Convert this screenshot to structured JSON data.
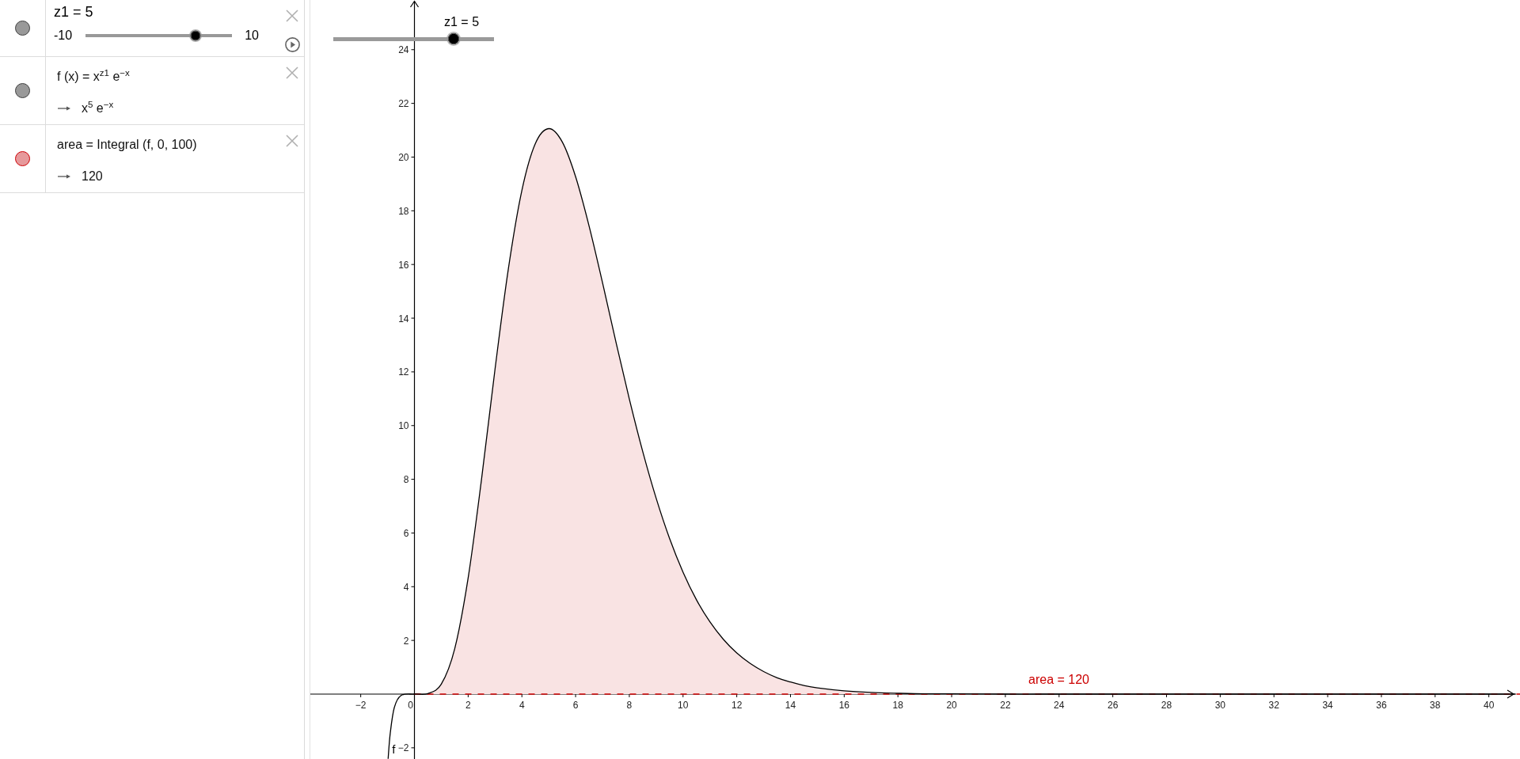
{
  "algebra_view": {
    "items": [
      {
        "kind": "slider",
        "visible": true,
        "color": "#999999",
        "definition": "z1 = 5",
        "min": "-10",
        "max": "10",
        "level": 0.75
      },
      {
        "kind": "formula",
        "visible": true,
        "color": "#999999",
        "definition": "f (x) = x$^{z1}$ e$^{−x}$",
        "output": "x$^{5}$ e$^{−x}$"
      },
      {
        "kind": "formula",
        "visible": true,
        "color": "#e6999b",
        "definition": "area = Integral (f, 0, 100)",
        "output": "120"
      }
    ]
  },
  "graphics_view": {
    "slider": {
      "caption": "z1 = 5",
      "level": 0.75
    },
    "chart_data": {
      "type": "line",
      "x": [
        -0.98,
        -0.9,
        -0.75,
        -0.5,
        0,
        0.5,
        1,
        1.5,
        2,
        2.5,
        3,
        3.5,
        4,
        4.5,
        5,
        5.5,
        6,
        6.5,
        7,
        7.5,
        8,
        8.5,
        9,
        9.5,
        10,
        10.5,
        11,
        11.5,
        12,
        12.5,
        13,
        13.5,
        14,
        14.5,
        15,
        16,
        17,
        18,
        19,
        20,
        22,
        24,
        26,
        28,
        30,
        32,
        34,
        36,
        38,
        40,
        41
      ],
      "series": [
        {
          "name": "area = 120",
          "type": "area",
          "color": "#cc0000",
          "values": [
            null,
            null,
            null,
            null,
            0,
            0.02,
            0.37,
            1.69,
            4.33,
            8.02,
            12.1,
            15.86,
            18.76,
            20.5,
            21.06,
            20.57,
            19.27,
            17.44,
            15.33,
            13.12,
            10.99,
            9.03,
            7.29,
            5.79,
            4.54,
            3.51,
            2.69,
            2.04,
            1.53,
            1.14,
            0.84,
            0.61,
            0.45,
            0.32,
            0.23,
            0.12,
            0.06,
            0.03,
            0.01,
            0.01,
            0,
            0,
            0,
            0,
            0,
            0,
            0,
            0,
            0,
            0,
            0
          ]
        },
        {
          "name": "f",
          "type": "line",
          "color": "#000000",
          "values": [
            -2.41,
            -1.45,
            -0.5,
            -0.05,
            0,
            0.02,
            0.37,
            1.69,
            4.33,
            8.02,
            12.1,
            15.86,
            18.76,
            20.5,
            21.06,
            20.57,
            19.27,
            17.44,
            15.33,
            13.12,
            10.99,
            9.03,
            7.29,
            5.79,
            4.54,
            3.51,
            2.69,
            2.04,
            1.53,
            1.14,
            0.84,
            0.61,
            0.45,
            0.32,
            0.23,
            0.12,
            0.06,
            0.03,
            0.01,
            0.01,
            0,
            0,
            0,
            0,
            0,
            0,
            0,
            0,
            0,
            0,
            0
          ]
        }
      ],
      "xlim": [
        -3.876,
        41.16
      ],
      "ylim": [
        -2.417,
        25.85
      ],
      "xticks": [
        {
          "value": -2,
          "label": "−2"
        },
        0,
        2,
        4,
        6,
        8,
        10,
        12,
        14,
        16,
        18,
        20,
        22,
        24,
        26,
        28,
        30,
        32,
        34,
        36,
        38,
        40
      ],
      "yticks": [
        {
          "value": -2,
          "label": "−2"
        },
        2,
        4,
        6,
        8,
        10,
        12,
        14,
        16,
        18,
        20,
        22,
        24
      ]
    }
  }
}
